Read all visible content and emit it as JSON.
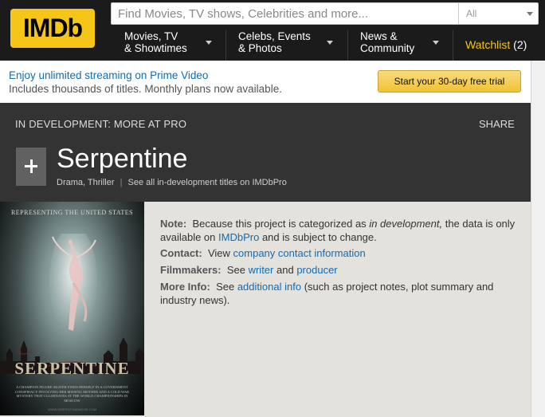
{
  "header": {
    "logo": "IMDb",
    "search_placeholder": "Find Movies, TV shows, Celebrities and more...",
    "search_category": "All",
    "nav": [
      {
        "line1": "Movies, TV",
        "line2": "& Showtimes"
      },
      {
        "line1": "Celebs, Events",
        "line2": "& Photos"
      },
      {
        "line1": "News &",
        "line2": "Community"
      }
    ],
    "watchlist_label": "Watchlist",
    "watchlist_count": "(2)"
  },
  "promo": {
    "title": "Enjoy unlimited streaming on Prime Video",
    "subtitle": "Includes thousands of titles. Monthly plans now available.",
    "button": "Start your 30-day free trial"
  },
  "title_header": {
    "dev_label": "IN DEVELOPMENT: MORE AT PRO",
    "share": "SHARE",
    "title": "Serpentine",
    "genres": "Drama, Thriller",
    "separator": "|",
    "see_all": "See all in-development titles on IMDbPro"
  },
  "poster": {
    "top_text": "REPRESENTING THE UNITED STATES",
    "title": "SERPENTINE",
    "tagline": "A CHAMPION FIGURE SKATER FINDS HERSELF IN A GOVERNMENT CONSPIRACY INVOLVING HER MISSING MOTHER AND A COLD WAR MYSTERY THAT CULMINATES AT THE WORLD CHAMPIONSHIPS IN MOSCOW",
    "url": "WWW.SERPENTINEMOVIE.COM"
  },
  "info": {
    "note_label": "Note:",
    "note_text1": "Because this project is categorized as",
    "note_em": "in development,",
    "note_text2": "the data is only available on",
    "note_link": "IMDbPro",
    "note_text3": "and is subject to change.",
    "contact_label": "Contact:",
    "contact_text": "View",
    "contact_link": "company contact information",
    "filmmakers_label": "Filmmakers:",
    "filmmakers_text": "See",
    "writer_link": "writer",
    "and_text": "and",
    "producer_link": "producer",
    "more_label": "More Info:",
    "more_text": "See",
    "more_link": "additional info",
    "more_text2": "(such as project notes, plot summary and industry news)."
  },
  "colors": {
    "brand": "#f5c518",
    "link": "#136cb2",
    "dark_header": "#333333"
  }
}
